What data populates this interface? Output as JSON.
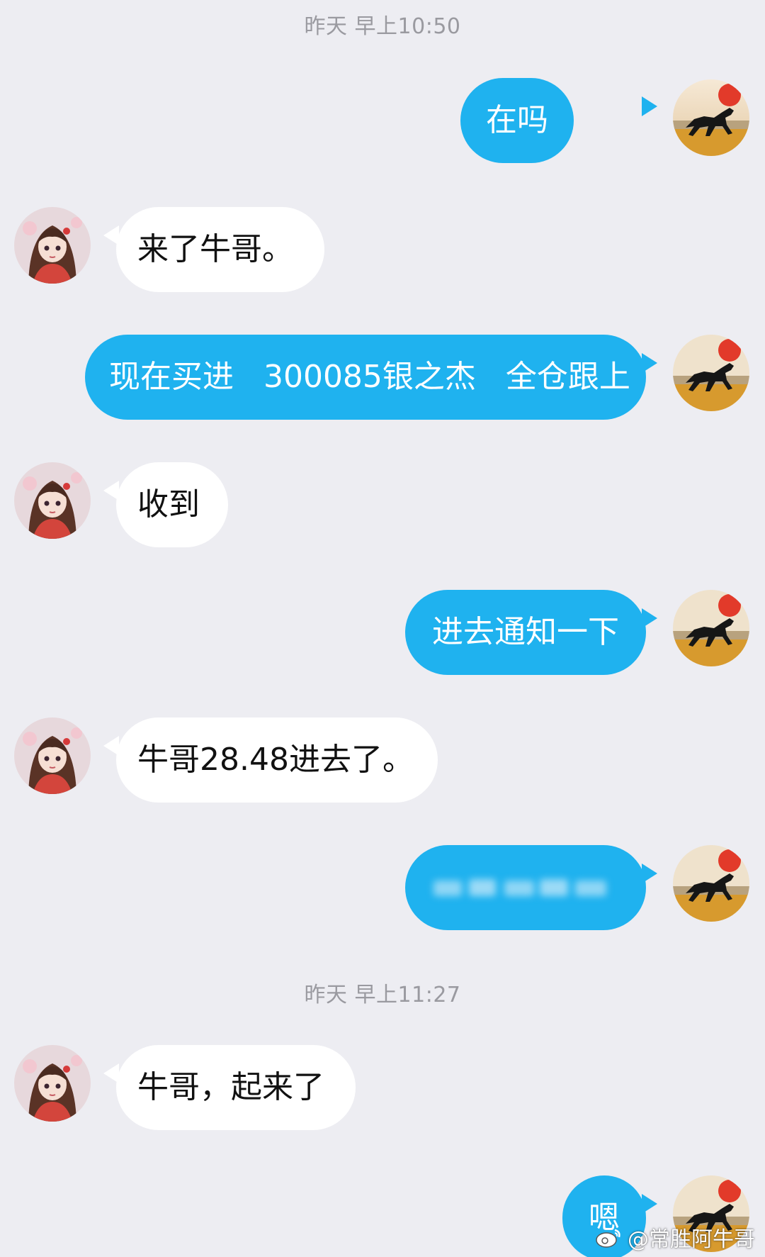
{
  "timestamps": [
    "昨天 早上10:50",
    "昨天 早上11:27"
  ],
  "messages": [
    {
      "side": "out",
      "text": "在吗"
    },
    {
      "side": "in",
      "text": "来了牛哥。"
    },
    {
      "side": "out",
      "text": "现在买进   300085银之杰   全仓跟上"
    },
    {
      "side": "in",
      "text": "收到"
    },
    {
      "side": "out",
      "text": "进去通知一下"
    },
    {
      "side": "in",
      "text": "牛哥28.48进去了。"
    },
    {
      "side": "out",
      "text": "",
      "blurred": true
    },
    {
      "side": "in",
      "text": "牛哥，起来了"
    },
    {
      "side": "out",
      "text": "嗯"
    }
  ],
  "watermark": {
    "text": "@常胜阿牛哥",
    "icon": "weibo-icon"
  },
  "colors": {
    "background": "#ededf2",
    "outgoing_bubble": "#1fb2ef",
    "incoming_bubble": "#ffffff",
    "timestamp_text": "#9a9aa0"
  },
  "avatars": {
    "self": "horse-sunset-avatar",
    "contact": "anime-girl-avatar"
  }
}
